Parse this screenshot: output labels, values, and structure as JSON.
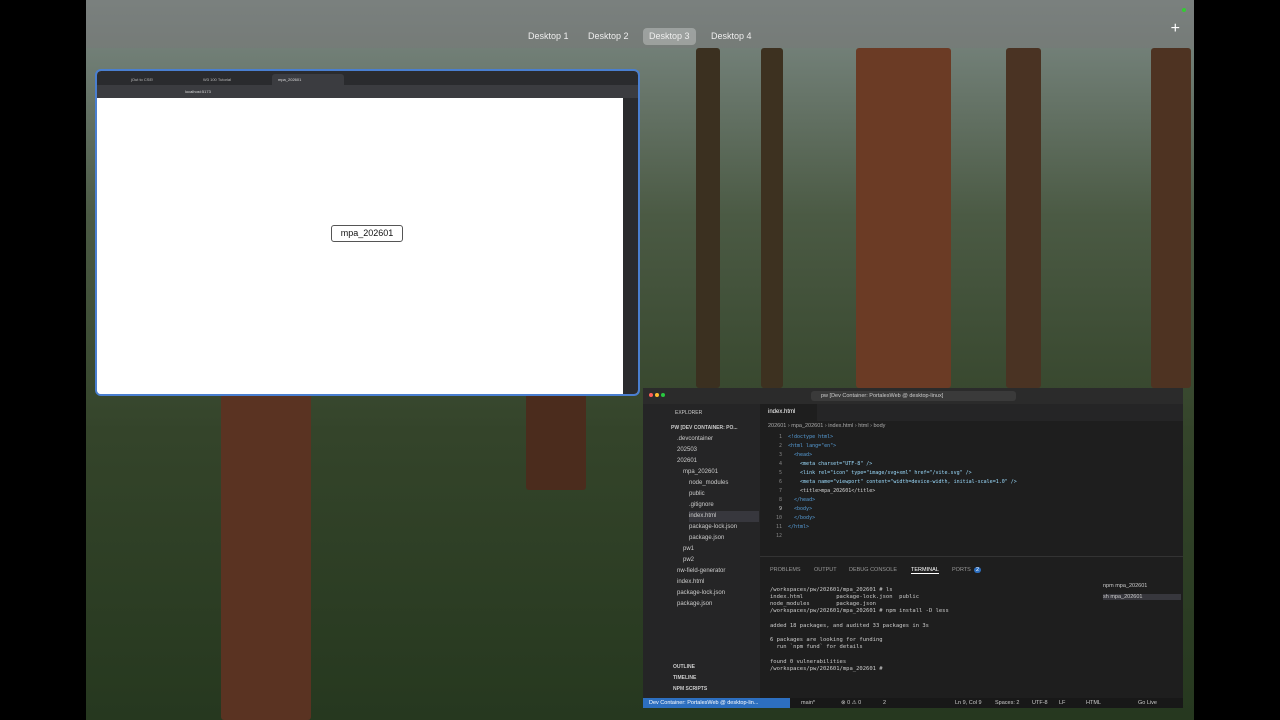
{
  "mission_control": {
    "desktops": [
      "Desktop 1",
      "Desktop 2",
      "Desktop 3",
      "Desktop 4"
    ],
    "active": "Desktop 3",
    "add_icon": "plus-icon"
  },
  "browser": {
    "tabs": [
      "jOut to CSE!",
      "W3 100 Tutorial",
      "mpa_202601"
    ],
    "url": "localhost:5173",
    "page_button": "mpa_202601"
  },
  "vscode": {
    "search": "pw [Dev Container: PortalesWeb @ desktop-linux]",
    "explorer_title": "EXPLORER",
    "workspace": "PW [DEV CONTAINER: PO...",
    "tree": [
      ".devcontainer",
      "202503",
      "202601",
      "mpa_202601",
      "node_modules",
      "public",
      ".gitignore",
      "index.html",
      "package-lock.json",
      "package.json",
      "pw1",
      "pw2",
      "nw-field-generator",
      "index.html",
      "package-lock.json",
      "package.json"
    ],
    "sections": [
      "OUTLINE",
      "TIMELINE",
      "NPM SCRIPTS"
    ],
    "tab": "index.html",
    "breadcrumb": "202601 › mpa_202601 › index.html › html › body",
    "code": [
      "<!doctype html>",
      "<html lang=\"en\">",
      "  <head>",
      "    <meta charset=\"UTF-8\" />",
      "    <link rel=\"icon\" type=\"image/svg+xml\" href=\"/vite.svg\" />",
      "    <meta name=\"viewport\" content=\"width=device-width, initial-scale=1.0\" />",
      "    <title>mpa_202601</title>",
      "  </head>",
      "  <body>",
      "  </body>",
      "</html>",
      ""
    ],
    "panel_tabs": [
      "PROBLEMS",
      "OUTPUT",
      "DEBUG CONSOLE",
      "TERMINAL",
      "PORTS"
    ],
    "ports_count": "2",
    "terminal": [
      "/workspaces/pw/202601/mpa_202601 # ls",
      "index.html          package-lock.json  public",
      "node_modules        package.json",
      "/workspaces/pw/202601/mpa_202601 # npm install -D less",
      "",
      "added 18 packages, and audited 33 packages in 3s",
      "",
      "6 packages are looking for funding",
      "  run `npm fund` for details",
      "",
      "found 0 vulnerabilities",
      "/workspaces/pw/202601/mpa_202601 # "
    ],
    "terminals": [
      "npm  mpa_202601",
      "sh  mpa_202601"
    ],
    "status": {
      "remote": "Dev Container: PortalesWeb @ desktop-lin...",
      "branch": "main*",
      "problems": "⊗ 0 ⚠ 0",
      "ports": "2",
      "position": "Ln 9, Col 9",
      "spaces": "Spaces: 2",
      "encoding": "UTF-8",
      "eol": "LF",
      "lang": "HTML",
      "golive": "Go Live"
    }
  }
}
